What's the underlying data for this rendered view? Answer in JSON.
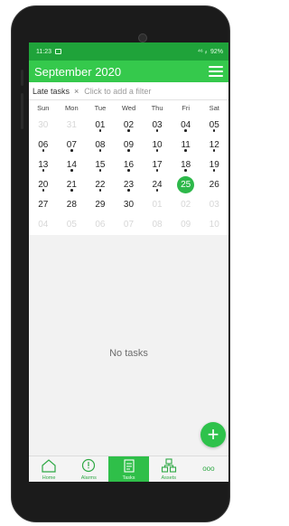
{
  "status_bar": {
    "time": "11:23",
    "signal": "⁴⁶ ᵢₗ",
    "battery": "92%"
  },
  "header": {
    "title": "September 2020"
  },
  "filter": {
    "chip_label": "Late tasks",
    "chip_remove": "×",
    "placeholder": "Click to add a filter"
  },
  "calendar": {
    "weekdays": [
      "Sun",
      "Mon",
      "Tue",
      "Wed",
      "Thu",
      "Fri",
      "Sat"
    ],
    "weeks": [
      [
        {
          "d": "30",
          "other": true
        },
        {
          "d": "31",
          "other": true
        },
        {
          "d": "01",
          "dot": true
        },
        {
          "d": "02",
          "dot": true
        },
        {
          "d": "03",
          "dot": true
        },
        {
          "d": "04",
          "dot": true
        },
        {
          "d": "05",
          "dot": true
        }
      ],
      [
        {
          "d": "06",
          "dot": true
        },
        {
          "d": "07",
          "dot": true
        },
        {
          "d": "08",
          "dot": true
        },
        {
          "d": "09",
          "dot": true
        },
        {
          "d": "10",
          "dot": true
        },
        {
          "d": "11",
          "dot": true
        },
        {
          "d": "12",
          "dot": true
        }
      ],
      [
        {
          "d": "13",
          "dot": true
        },
        {
          "d": "14",
          "dot": true
        },
        {
          "d": "15",
          "dot": true
        },
        {
          "d": "16",
          "dot": true
        },
        {
          "d": "17",
          "dot": true
        },
        {
          "d": "18",
          "dot": true
        },
        {
          "d": "19",
          "dot": true
        }
      ],
      [
        {
          "d": "20",
          "dot": true
        },
        {
          "d": "21",
          "dot": true
        },
        {
          "d": "22",
          "dot": true
        },
        {
          "d": "23",
          "dot": true
        },
        {
          "d": "24",
          "dot": true
        },
        {
          "d": "25",
          "today": true
        },
        {
          "d": "26"
        }
      ],
      [
        {
          "d": "27"
        },
        {
          "d": "28"
        },
        {
          "d": "29"
        },
        {
          "d": "30"
        },
        {
          "d": "01",
          "other": true
        },
        {
          "d": "02",
          "other": true
        },
        {
          "d": "03",
          "other": true
        }
      ],
      [
        {
          "d": "04",
          "other": true
        },
        {
          "d": "05",
          "other": true
        },
        {
          "d": "06",
          "other": true
        },
        {
          "d": "07",
          "other": true
        },
        {
          "d": "08",
          "other": true
        },
        {
          "d": "09",
          "other": true
        },
        {
          "d": "10",
          "other": true
        }
      ]
    ]
  },
  "main": {
    "empty_text": "No tasks"
  },
  "fab": {
    "label": "+"
  },
  "nav": {
    "items": [
      {
        "label": "Home",
        "icon": "home-icon"
      },
      {
        "label": "Alarms",
        "icon": "alarm-icon"
      },
      {
        "label": "Tasks",
        "icon": "tasks-icon",
        "active": true
      },
      {
        "label": "Assets",
        "icon": "assets-icon"
      },
      {
        "label": "",
        "icon": "more-icon"
      }
    ],
    "more_glyph": "ooo"
  },
  "colors": {
    "status_green": "#1fa33a",
    "header_green": "#35c94c",
    "accent": "#2db84a"
  }
}
